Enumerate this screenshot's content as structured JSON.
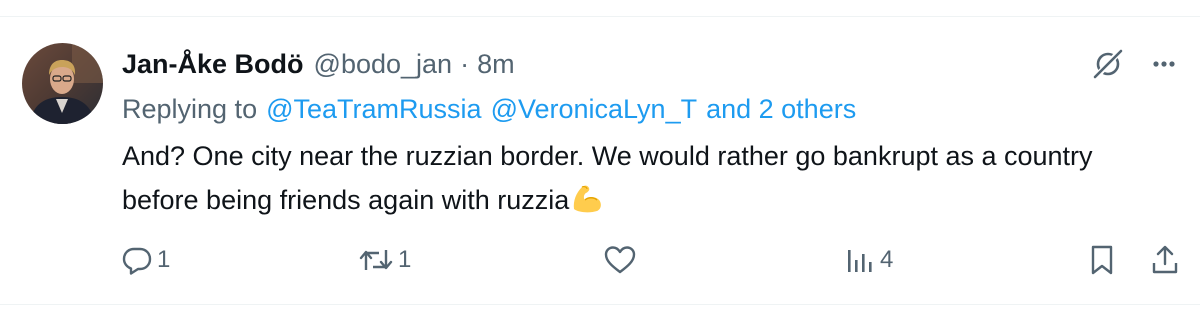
{
  "tweet": {
    "display_name": "Jan-Åke Bodö",
    "handle": "@bodo_jan",
    "separator": "·",
    "time": "8m",
    "replying_prefix": "Replying to",
    "mentions": [
      "@TeaTramRussia",
      "@VeronicaLyn_T",
      "and 2 others"
    ],
    "text": "And? One city near the ruzzian border. We would rather go bankrupt as a country before being friends again with ruzzia",
    "emoji_icon": "flexed-biceps-emoji"
  },
  "actions": {
    "reply_count": "1",
    "repost_count": "1",
    "like_count": "",
    "views_count": "4"
  },
  "icons": {
    "header": [
      "grok-icon",
      "more-icon"
    ],
    "actions": [
      "reply-icon",
      "repost-icon",
      "like-icon",
      "views-icon",
      "bookmark-icon",
      "share-icon"
    ]
  },
  "colors": {
    "text_primary": "#0f1419",
    "text_secondary": "#536471",
    "link": "#1d9bf0",
    "divider": "#eff3f4",
    "emoji": "#ffcc4d"
  }
}
